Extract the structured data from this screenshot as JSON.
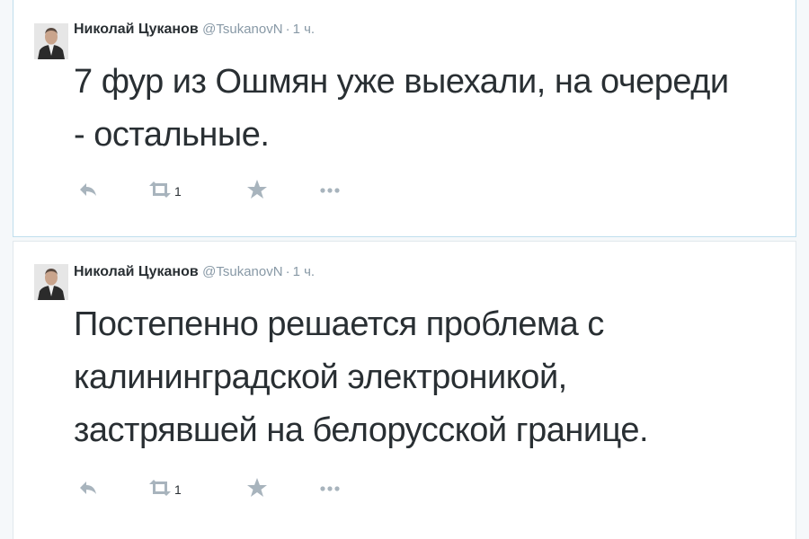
{
  "tweets": [
    {
      "author_name": "Николай Цуканов",
      "author_handle": "@TsukanovN",
      "separator": "·",
      "time": "1 ч.",
      "text_lines": [
        "7 фур из Ошмян уже выехали, на очереди",
        "- остальные."
      ],
      "retweet_count": "1",
      "icons": [
        "reply-icon",
        "retweet-icon",
        "favorite-icon",
        "more-icon"
      ]
    },
    {
      "author_name": "Николай Цуканов",
      "author_handle": "@TsukanovN",
      "separator": "·",
      "time": "1 ч.",
      "text_lines": [
        "Постепенно решается проблема с",
        "калининградской электроникой,",
        "застрявшей на белорусской границе."
      ],
      "retweet_count": "1",
      "icons": [
        "reply-icon",
        "retweet-icon",
        "favorite-icon",
        "more-icon"
      ]
    }
  ],
  "colors": {
    "background": "#f5f8fa",
    "card": "#ffffff",
    "selected_border": "#c0deed",
    "text": "#292f33",
    "muted": "#8899a6",
    "icon": "#a8b4bd"
  }
}
